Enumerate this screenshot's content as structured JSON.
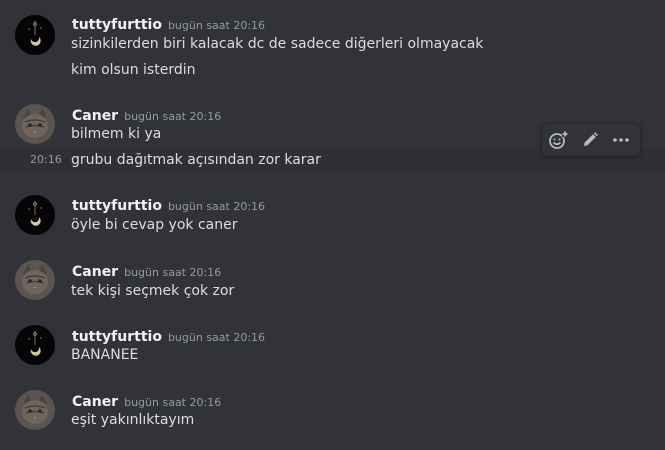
{
  "messages": [
    {
      "author": "tuttyfurttio",
      "time": "bugün saat 20:16",
      "lines": [
        "sizinkilerden biri kalacak dc de sadece diğerleri olmayacak",
        "kim olsun isterdin"
      ]
    },
    {
      "author": "Caner",
      "time": "bugün saat 20:16",
      "lines": [
        "bilmem ki ya",
        "grubu dağıtmak açısından zor karar"
      ],
      "hover_time": "20:16"
    },
    {
      "author": "tuttyfurttio",
      "time": "bugün saat 20:16",
      "lines": [
        "öyle bi cevap yok caner"
      ]
    },
    {
      "author": "Caner",
      "time": "bugün saat 20:16",
      "lines": [
        "tek kişi seçmek çok zor"
      ]
    },
    {
      "author": "tuttyfurttio",
      "time": "bugün saat 20:16",
      "lines": [
        "BANANEE"
      ]
    },
    {
      "author": "Caner",
      "time": "bugün saat 20:16",
      "lines": [
        "eşit yakınlıktayım"
      ]
    }
  ],
  "toolbar": {
    "icons": [
      "add-reaction-icon",
      "edit-icon",
      "more-icon"
    ]
  }
}
